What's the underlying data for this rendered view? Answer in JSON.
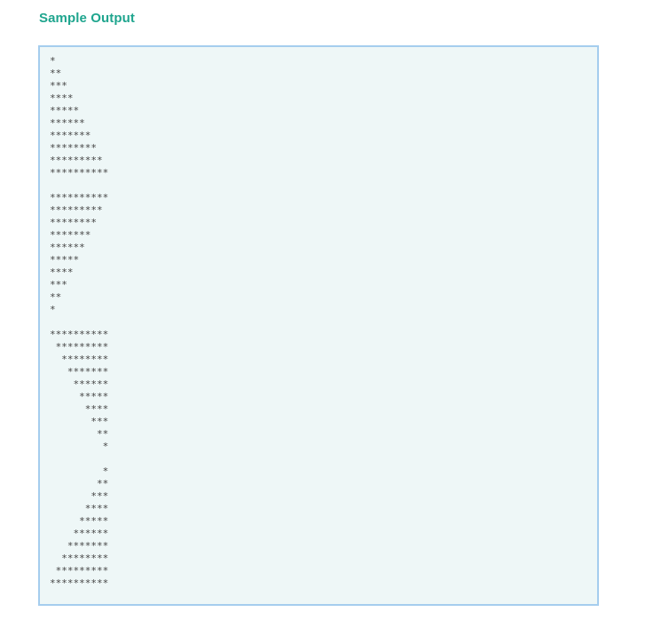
{
  "title": "Sample Output",
  "output_blocks": [
    [
      "*",
      "**",
      "***",
      "****",
      "*****",
      "******",
      "*******",
      "********",
      "*********",
      "**********"
    ],
    [
      "**********",
      "*********",
      "********",
      "*******",
      "******",
      "*****",
      "****",
      "***",
      "**",
      "*"
    ],
    [
      "**********",
      " *********",
      "  ********",
      "   *******",
      "    ******",
      "     *****",
      "      ****",
      "       ***",
      "        **",
      "         *"
    ],
    [
      "         *",
      "        **",
      "       ***",
      "      ****",
      "     *****",
      "    ******",
      "   *******",
      "  ********",
      " *********",
      "**********"
    ]
  ]
}
